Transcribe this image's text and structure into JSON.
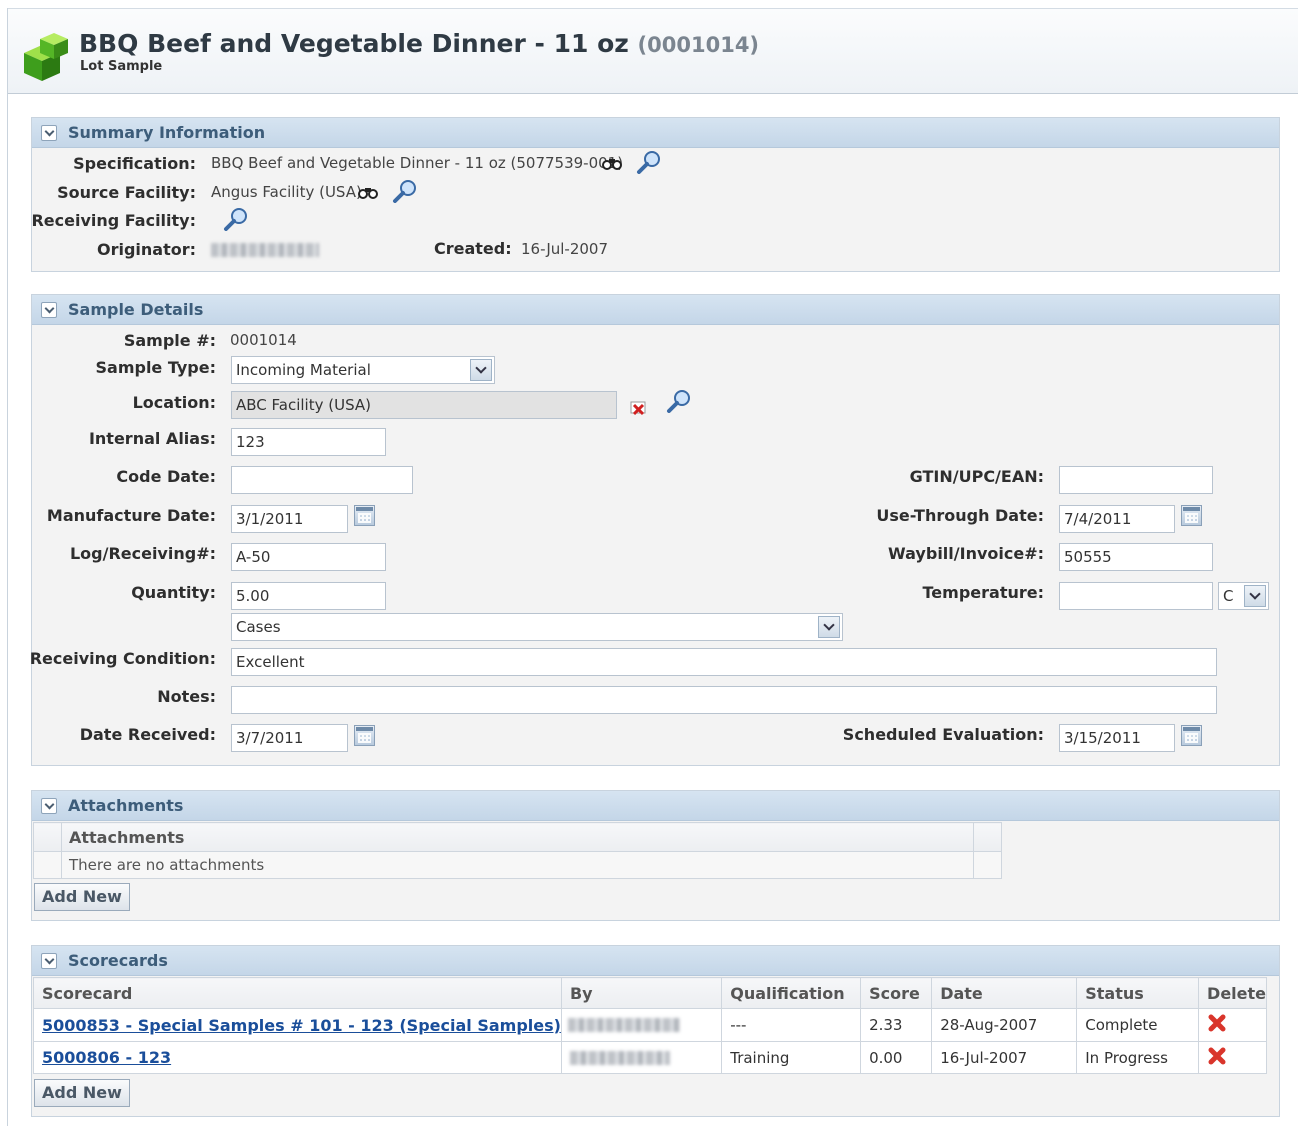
{
  "header": {
    "title": "BBQ Beef and Vegetable Dinner - 11 oz",
    "number": "(0001014)",
    "subtitle": "Lot Sample"
  },
  "summary": {
    "title": "Summary Information",
    "specification_label": "Specification:",
    "specification_value": "BBQ Beef and Vegetable Dinner - 11 oz (5077539-001)",
    "source_facility_label": "Source Facility:",
    "source_facility_value": "Angus Facility (USA)",
    "receiving_facility_label": "Receiving Facility:",
    "originator_label": "Originator:",
    "created_label": "Created:",
    "created_value": "16-Jul-2007"
  },
  "sample": {
    "title": "Sample Details",
    "sample_num_label": "Sample #:",
    "sample_num_value": "0001014",
    "sample_type_label": "Sample Type:",
    "sample_type_value": "Incoming Material",
    "location_label": "Location:",
    "location_value": "ABC Facility (USA)",
    "internal_alias_label": "Internal Alias:",
    "internal_alias_value": "123",
    "code_date_label": "Code Date:",
    "code_date_value": "",
    "gtin_label": "GTIN/UPC/EAN:",
    "gtin_value": "",
    "manufacture_date_label": "Manufacture Date:",
    "manufacture_date_value": "3/1/2011",
    "use_through_label": "Use-Through Date:",
    "use_through_value": "7/4/2011",
    "log_receiving_label": "Log/Receiving#:",
    "log_receiving_value": "A-50",
    "waybill_label": "Waybill/Invoice#:",
    "waybill_value": "50555",
    "quantity_label": "Quantity:",
    "quantity_value": "5.00",
    "unit_value": "Cases",
    "temperature_label": "Temperature:",
    "temperature_value": "",
    "temperature_unit": "C",
    "receiving_condition_label": "Receiving Condition:",
    "receiving_condition_value": "Excellent",
    "notes_label": "Notes:",
    "notes_value": "",
    "date_received_label": "Date Received:",
    "date_received_value": "3/7/2011",
    "scheduled_eval_label": "Scheduled Evaluation:",
    "scheduled_eval_value": "3/15/2011"
  },
  "attachments": {
    "title": "Attachments",
    "column": "Attachments",
    "empty_text": "There are no attachments",
    "add_new": "Add New"
  },
  "scorecards": {
    "title": "Scorecards",
    "columns": [
      "Scorecard",
      "By",
      "Qualification",
      "Score",
      "Date",
      "Status",
      "Delete"
    ],
    "rows": [
      {
        "scorecard": "5000853 - Special Samples # 101 - 123 (Special Samples)",
        "qualification": "---",
        "score": "2.33",
        "date": "28-Aug-2007",
        "status": "Complete"
      },
      {
        "scorecard": "5000806 - 123",
        "qualification": "Training",
        "score": "0.00",
        "date": "16-Jul-2007",
        "status": "In Progress"
      }
    ],
    "add_new": "Add New"
  },
  "colors": {
    "panel_header": "#c4d6e8",
    "link": "#1a4e9a",
    "delete_red": "#d9352b"
  }
}
